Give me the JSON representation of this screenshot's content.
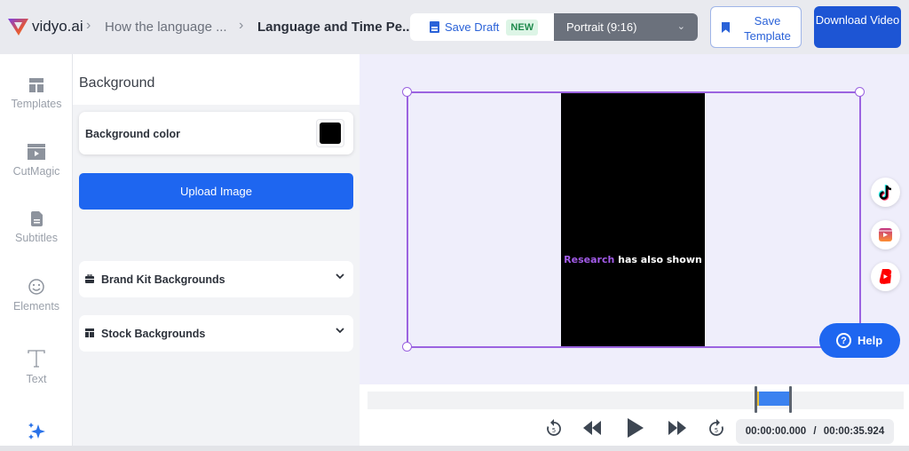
{
  "header": {
    "brand": "vidyo.ai",
    "breadcrumbs": [
      "How the language ...",
      "Language and Time Pe..."
    ],
    "save_draft": {
      "label": "Save Draft",
      "badge": "NEW"
    },
    "aspect_ratio": {
      "selected": "Portrait (9:16)"
    },
    "save_template": "Save Template",
    "download": "Download Video"
  },
  "sidebar": {
    "items": [
      {
        "label": "Templates",
        "icon": "templates-icon"
      },
      {
        "label": "CutMagic",
        "icon": "clapperboard-icon"
      },
      {
        "label": "Subtitles",
        "icon": "document-icon"
      },
      {
        "label": "Elements",
        "icon": "smiley-icon"
      },
      {
        "label": "Text",
        "icon": "text-icon"
      },
      {
        "label": "",
        "icon": "sparkle-icon"
      }
    ]
  },
  "panel": {
    "title": "Background",
    "background_color": {
      "label": "Background color",
      "value": "#000000"
    },
    "upload_button": "Upload Image",
    "accordions": [
      {
        "label": "Brand Kit Backgrounds",
        "icon": "briefcase-icon"
      },
      {
        "label": "Stock Backgrounds",
        "icon": "layout-icon"
      }
    ]
  },
  "canvas": {
    "caption_highlight": "Research",
    "caption_rest": " has also shown",
    "accent_color": "#a25be8",
    "social": [
      "tiktok-icon",
      "instagram-reels-icon",
      "youtube-shorts-icon"
    ],
    "help_label": "Help"
  },
  "player": {
    "current_time": "00:00:00.000",
    "separator": "/",
    "total_time": "00:00:35.924",
    "time_display": "00:00:00.000  /  00:00:35.924"
  },
  "colors": {
    "primary": "#1e66f0",
    "download": "#1d55d4",
    "selection": "#9b63e0"
  }
}
